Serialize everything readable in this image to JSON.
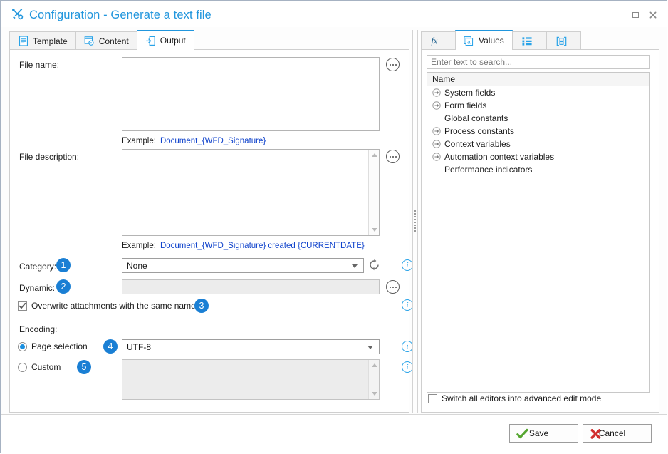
{
  "window": {
    "title": "Configuration - Generate a text file",
    "title_icon": "tools-icon",
    "maximize_label": "Maximize",
    "close_label": "Close"
  },
  "left_tabs": [
    {
      "label": "Template",
      "icon": "template-document-icon",
      "active": false
    },
    {
      "label": "Content",
      "icon": "content-gear-icon",
      "active": false
    },
    {
      "label": "Output",
      "icon": "output-arrow-icon",
      "active": true
    }
  ],
  "form": {
    "file_name": {
      "label": "File name:",
      "value": "",
      "example_label": "Example:",
      "example_value": "Document_{WFD_Signature}",
      "more_button": "…"
    },
    "file_description": {
      "label": "File description:",
      "value": "",
      "example_label": "Example:",
      "example_value": "Document_{WFD_Signature} created {CURRENTDATE}",
      "more_button": "…"
    },
    "category": {
      "label": "Category:",
      "badge": "1",
      "value": "None",
      "refresh_icon": "refresh-icon",
      "info_icon": "info-icon"
    },
    "dynamic": {
      "label": "Dynamic:",
      "badge": "2",
      "value": "",
      "more_button": "…"
    },
    "overwrite": {
      "label": "Overwrite attachments with the same name",
      "badge": "3",
      "checked": true,
      "info_icon": "info-icon"
    },
    "encoding": {
      "label": "Encoding:",
      "page_selection": {
        "label": "Page selection",
        "badge": "4",
        "selected": true,
        "value": "UTF-8",
        "info_icon": "info-icon"
      },
      "custom": {
        "label": "Custom",
        "badge": "5",
        "selected": false,
        "value": "",
        "info_icon": "info-icon"
      }
    }
  },
  "right_panel": {
    "tabs": [
      {
        "label": "",
        "icon": "function-fx-icon",
        "active": false
      },
      {
        "label": "Values",
        "icon": "values-a-icon",
        "active": true
      },
      {
        "label": "",
        "icon": "list-items-icon",
        "active": false
      },
      {
        "label": "",
        "icon": "bracket-box-icon",
        "active": false
      }
    ],
    "search": {
      "placeholder": "Enter text to search...",
      "value": ""
    },
    "column_header": "Name",
    "tree_items": [
      {
        "label": "System fields",
        "expandable": true
      },
      {
        "label": "Form fields",
        "expandable": true
      },
      {
        "label": "Global constants",
        "expandable": false
      },
      {
        "label": "Process constants",
        "expandable": true
      },
      {
        "label": "Context variables",
        "expandable": true
      },
      {
        "label": "Automation context variables",
        "expandable": true
      },
      {
        "label": "Performance indicators",
        "expandable": false
      }
    ],
    "advanced_mode": {
      "label": "Switch all editors into advanced edit mode",
      "checked": false
    }
  },
  "footer": {
    "save_label": "Save",
    "cancel_label": "Cancel"
  },
  "colors": {
    "accent": "#2196dd",
    "badge": "#1a7fd4",
    "example_link": "#1144cc",
    "save_check": "#55a630",
    "cancel_x": "#d12f2f"
  }
}
